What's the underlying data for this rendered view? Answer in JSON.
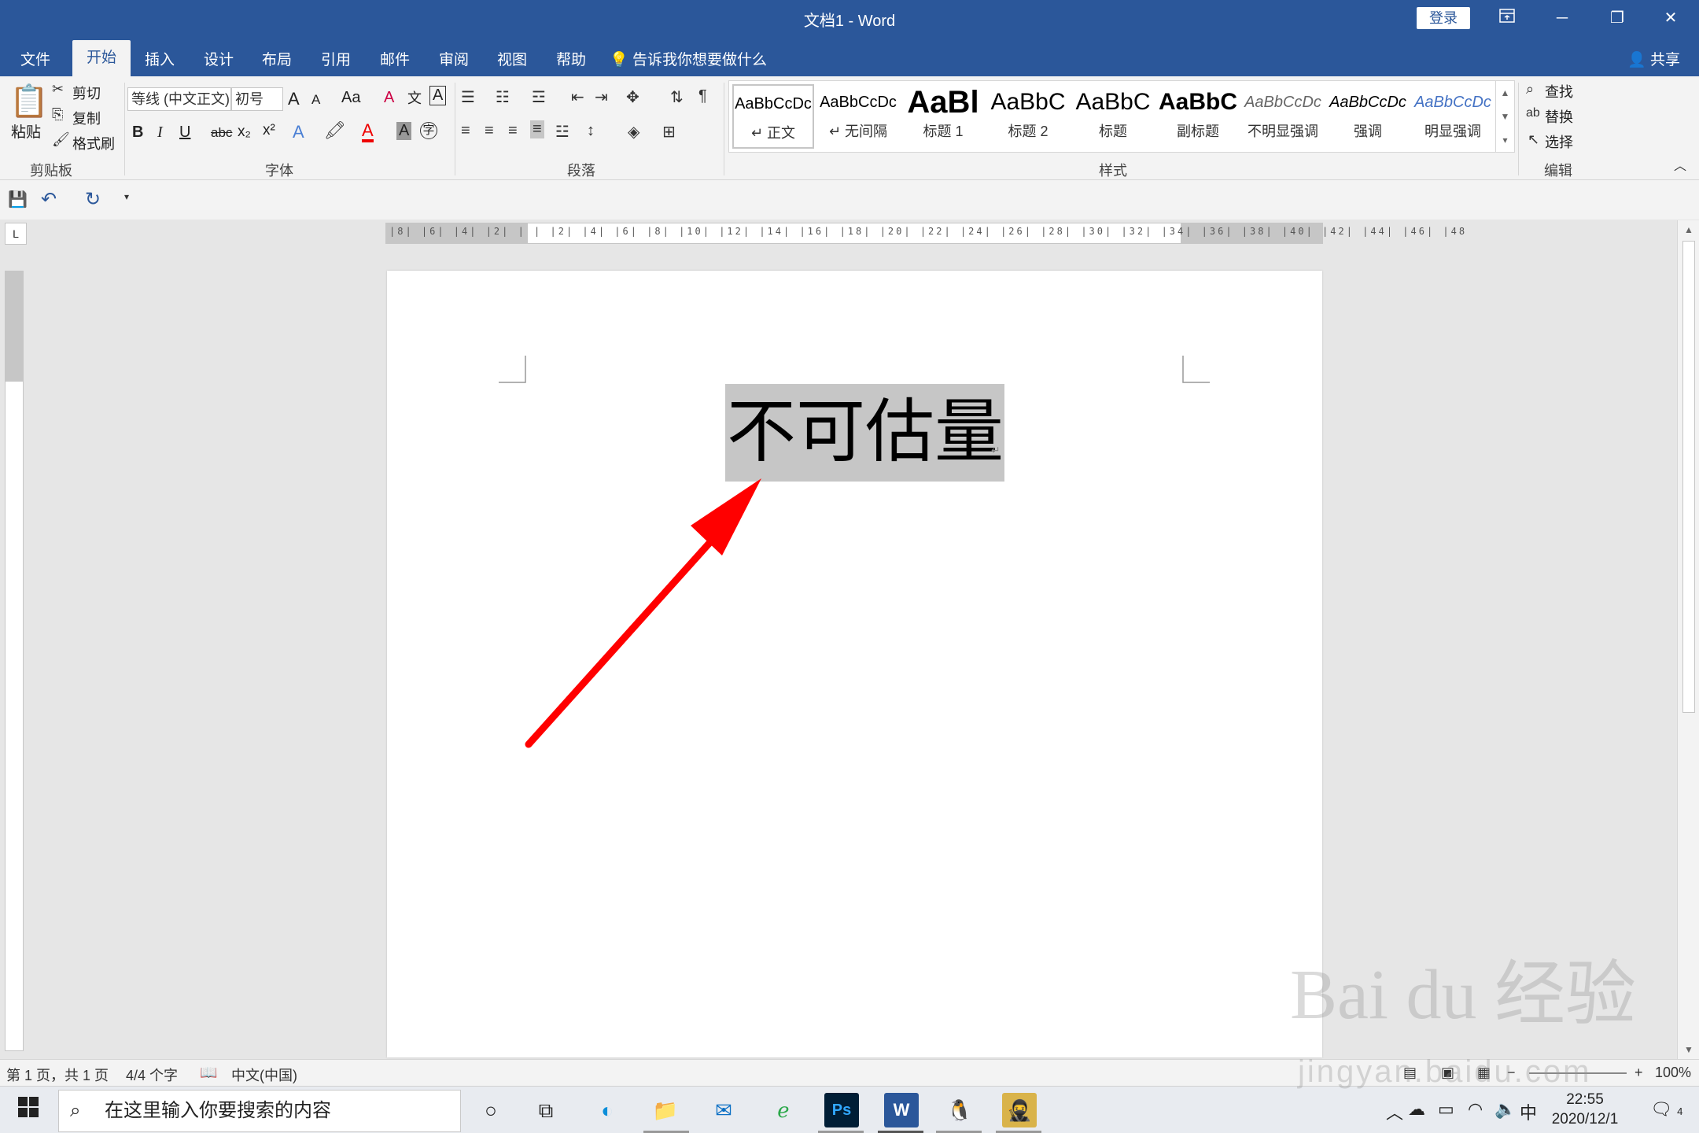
{
  "window": {
    "title": "文档1  -  Word",
    "login": "登录",
    "ribbon_display_icon": "ribbon-display-icon",
    "minimize": "─",
    "restore": "❐",
    "close": "✕"
  },
  "tabs": [
    "文件",
    "开始",
    "插入",
    "设计",
    "布局",
    "引用",
    "邮件",
    "审阅",
    "视图",
    "帮助"
  ],
  "tell_me": "告诉我你想要做什么",
  "share": "共享",
  "clipboard": {
    "paste": "粘贴",
    "cut": "剪切",
    "copy": "复制",
    "format_painter": "格式刷",
    "label": "剪贴板"
  },
  "font": {
    "family": "等线 (中文正文)",
    "size": "初号",
    "label": "字体",
    "bold": "B",
    "italic": "I",
    "underline": "U",
    "strike": "abc",
    "subscript": "x₂",
    "superscript": "x²",
    "grow": "A",
    "shrink": "A",
    "case": "Aa",
    "clear": "A",
    "phonetic": "文",
    "border": "A",
    "effect": "A",
    "color": "A",
    "shading": "A",
    "enclose": "字"
  },
  "paragraph": {
    "label": "段落"
  },
  "styles": {
    "label": "样式",
    "items": [
      {
        "sample": "AaBbCcDc",
        "name": "↵ 正文"
      },
      {
        "sample": "AaBbCcDc",
        "name": "↵ 无间隔"
      },
      {
        "sample": "AaBl",
        "name": "标题 1"
      },
      {
        "sample": "AaBbC",
        "name": "标题 2"
      },
      {
        "sample": "AaBbC",
        "name": "标题"
      },
      {
        "sample": "AaBbC",
        "name": "副标题"
      },
      {
        "sample": "AaBbCcDc",
        "name": "不明显强调"
      },
      {
        "sample": "AaBbCcDc",
        "name": "强调"
      },
      {
        "sample": "AaBbCcDc",
        "name": "明显强调"
      }
    ]
  },
  "editing": {
    "find": "查找",
    "replace": "替换",
    "select": "选择",
    "label": "编辑"
  },
  "ruler": {
    "corner": "L",
    "h_numbers": "|8| |6| |4| |2| |  | |2| |4| |6| |8| |10| |12| |14| |16| |18| |20| |22| |24| |26| |28| |30| |32| |34| |36| |38| |40| |42| |44| |46| |48"
  },
  "document": {
    "text": "不可估量",
    "para_mark": "↵"
  },
  "status": {
    "page": "第 1 页，共 1 页",
    "words": "4/4 个字",
    "language": "中文(中国)",
    "zoom": "100%"
  },
  "taskbar": {
    "search_placeholder": "在这里输入你要搜索的内容",
    "time": "22:55",
    "date": "2020/12/1",
    "ime": "中",
    "notifications": "4"
  },
  "watermark": {
    "main": "Bai du 经验",
    "sub": "jingyan.baidu.com"
  },
  "colors": {
    "brand": "#2b579a",
    "arrow": "#ff0000",
    "selection": "#c6c6c6"
  }
}
